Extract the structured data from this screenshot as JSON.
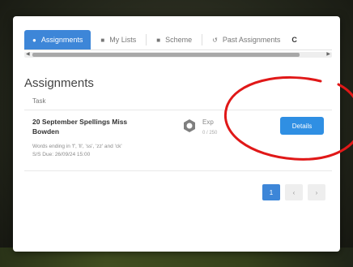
{
  "tabs": [
    {
      "label": "Assignments",
      "icon": "assignments-icon",
      "active": true
    },
    {
      "label": "My Lists",
      "icon": "list-icon",
      "active": false
    },
    {
      "label": "Scheme",
      "icon": "scheme-icon",
      "active": false
    },
    {
      "label": "Past Assignments",
      "icon": "history-icon",
      "active": false
    },
    {
      "label": "C",
      "icon": "",
      "active": false
    }
  ],
  "heading": "Assignments",
  "table": {
    "column_task": "Task"
  },
  "assignment": {
    "title": "20 September Spellings Miss Bowden",
    "description": "Words ending in 'f', 'll', 'ss', 'zz' and 'ck'",
    "due": "S/S Due: 26/09/24 15:00",
    "status_label": "Exp",
    "status_sub": "0 / 250",
    "details_label": "Details"
  },
  "pagination": {
    "current": "1",
    "prev": "‹",
    "next": "›"
  },
  "colors": {
    "accent": "#3d86d8",
    "button": "#2f8fe3",
    "annotation": "#e01818"
  }
}
